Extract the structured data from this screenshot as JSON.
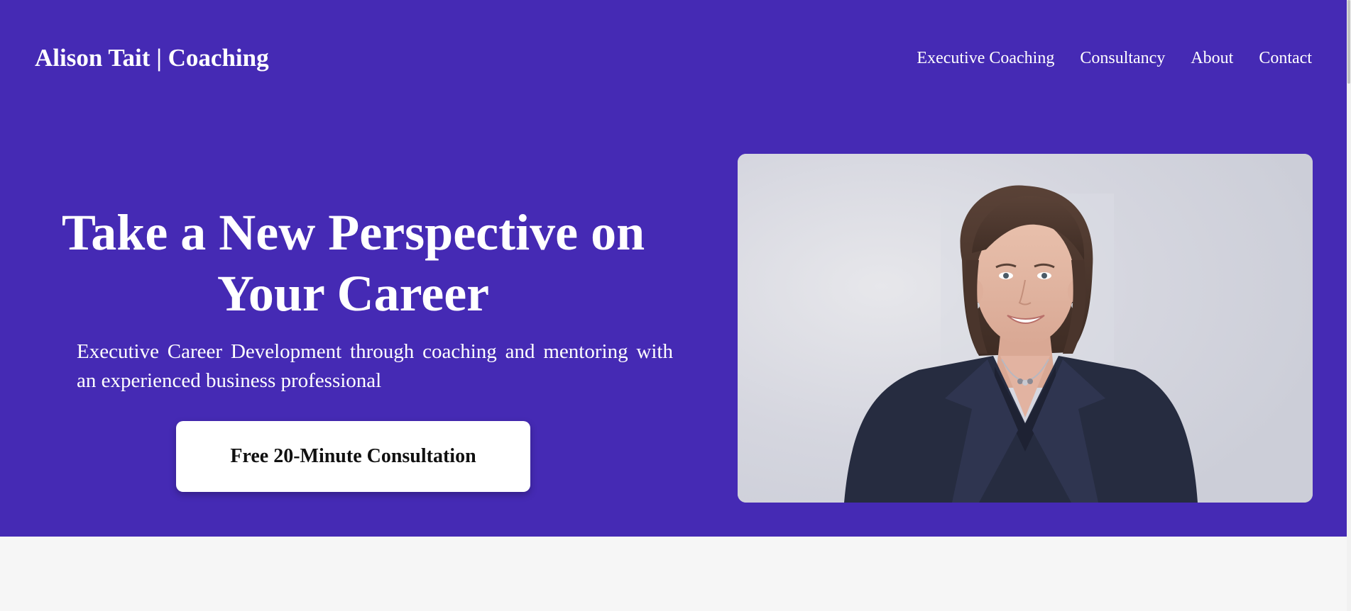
{
  "header": {
    "brand": "Alison Tait | Coaching",
    "nav": [
      {
        "label": "Executive Coaching"
      },
      {
        "label": "Consultancy"
      },
      {
        "label": "About"
      },
      {
        "label": "Contact"
      }
    ]
  },
  "hero": {
    "title": "Take a New Perspective on Your Career",
    "subtitle": "Executive Career Development through coaching and mentoring with an experienced business professional",
    "cta_label": "Free 20-Minute Consultation"
  },
  "colors": {
    "brand_purple": "#452ab4",
    "text_light": "#ffffff",
    "button_bg": "#ffffff",
    "page_bg": "#f6f6f6"
  }
}
